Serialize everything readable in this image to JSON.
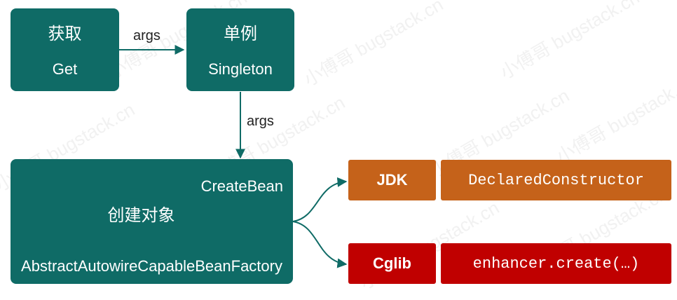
{
  "get_box": {
    "title": "获取",
    "subtitle": "Get"
  },
  "singleton_box": {
    "title": "单例",
    "subtitle": "Singleton"
  },
  "arrow_get_to_singleton": {
    "label": "args"
  },
  "arrow_singleton_to_create": {
    "label": "args"
  },
  "create_box": {
    "top_label": "CreateBean",
    "title": "创建对象",
    "bottom_label": "AbstractAutowireCapableBeanFactory"
  },
  "jdk_row": {
    "tag": "JDK",
    "detail": "DeclaredConstructor"
  },
  "cglib_row": {
    "tag": "Cglib",
    "detail": "enhancer.create(…)"
  },
  "colors": {
    "teal": "#0f6b66",
    "orange": "#c5621a",
    "red": "#c00000"
  },
  "watermark": {
    "text": "小傅哥 bugstack.cn"
  }
}
